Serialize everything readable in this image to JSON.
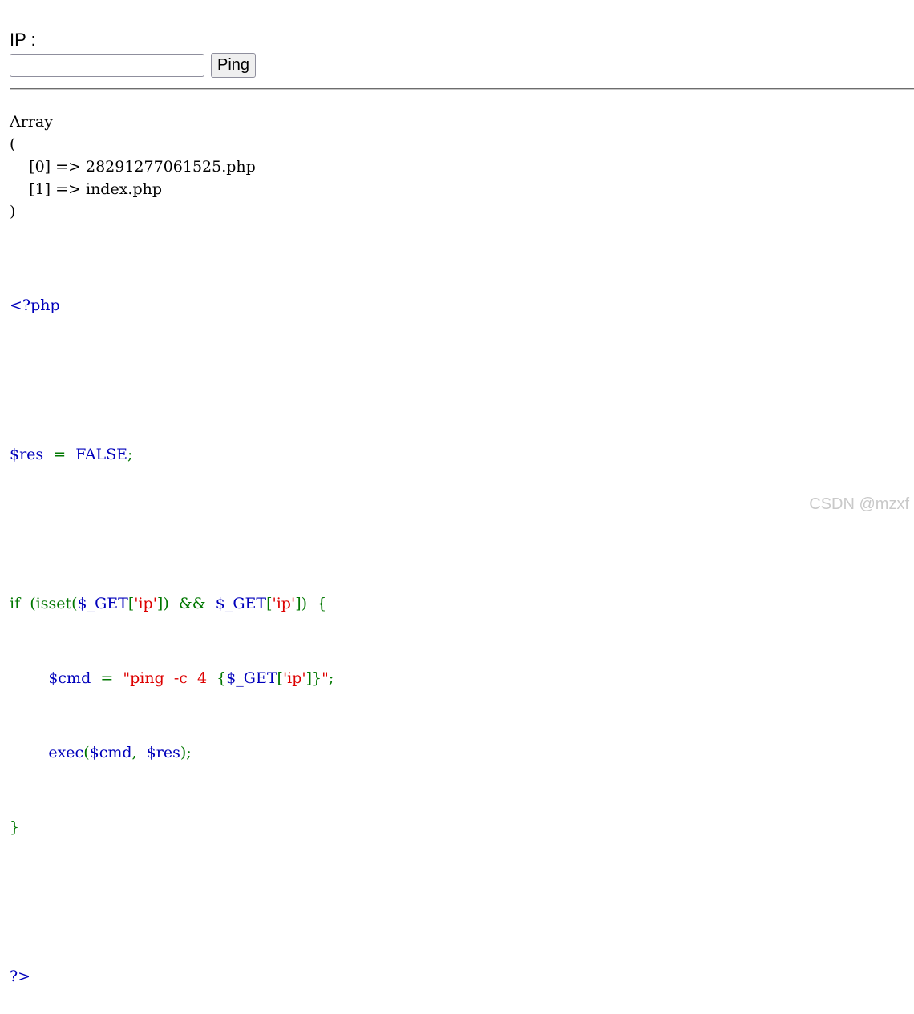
{
  "form": {
    "label": "IP :",
    "input_value": "",
    "input_placeholder": "",
    "button_label": "Ping"
  },
  "output": {
    "lines": [
      "Array",
      "(",
      "    [0] => 28291277061525.php",
      "    [1] => index.php",
      ")"
    ]
  },
  "source": {
    "open_tag": "<?php",
    "line_res": {
      "var": "$res",
      "eq": "=",
      "val": "FALSE",
      "semi": ";"
    },
    "line_if": {
      "kw": "if",
      "p1": "(isset(",
      "get1": "$_GET",
      "b1": "[",
      "s1": "'ip'",
      "b2": "])",
      "and": "&&",
      "get2": "$_GET",
      "b3": "[",
      "s2": "'ip'",
      "b4": "])",
      "brace": "{"
    },
    "line_cmd": {
      "var": "$cmd",
      "eq": "=",
      "str1": "\"ping  -c  4  ",
      "brace_open": "{",
      "get": "$_GET",
      "b1": "[",
      "s": "'ip'",
      "b2": "]}",
      "str2": "\"",
      "semi": ";"
    },
    "line_exec": {
      "fn": "exec",
      "p1": "(",
      "arg1": "$cmd",
      "comma": ",",
      "arg2": "$res",
      "p2": ");"
    },
    "close_brace": "}",
    "close_tag": "?>"
  },
  "watermark": "CSDN @mzxf",
  "colors": {
    "default": "#0000bb",
    "keyword": "#007700",
    "string": "#dd0000"
  }
}
